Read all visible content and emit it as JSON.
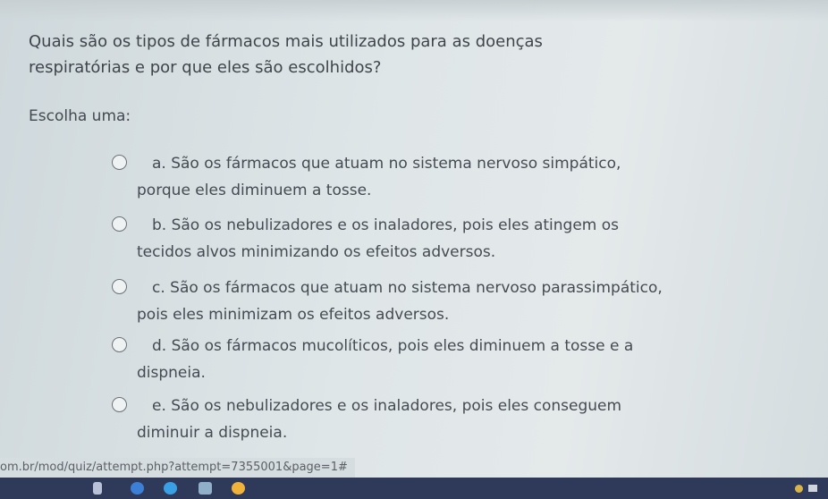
{
  "question": {
    "line1": "Quais são os tipos de fármacos mais utilizados para as doenças",
    "line2": "respiratórias e por que eles são escolhidos?"
  },
  "prompt": "Escolha uma:",
  "options": [
    {
      "line1": "a. São os fármacos que atuam no sistema nervoso simpático,",
      "line2": "porque eles diminuem a tosse."
    },
    {
      "line1": "b. São os nebulizadores e os inaladores, pois eles atingem os",
      "line2": "tecidos alvos minimizando os efeitos adversos."
    },
    {
      "line1": "c. São os fármacos que atuam no sistema nervoso parassimpático,",
      "line2": "pois eles minimizam os efeitos adversos."
    },
    {
      "line1": "d. São os fármacos mucolíticos, pois eles diminuem a tosse e a",
      "line2": "dispneia."
    },
    {
      "line1": "e. São os nebulizadores e os inaladores, pois eles conseguem",
      "line2": "diminuir a dispneia."
    }
  ],
  "status_url": "om.br/mod/quiz/attempt.php?attempt=7355001&page=1#"
}
